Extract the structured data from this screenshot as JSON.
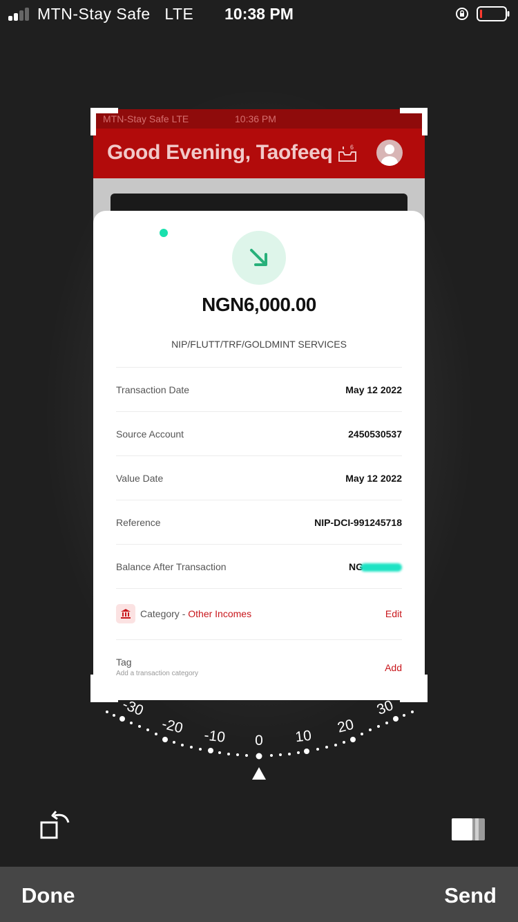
{
  "status_bar": {
    "carrier": "MTN-Stay Safe",
    "network": "LTE",
    "time": "10:38 PM"
  },
  "preview": {
    "mini_status": {
      "carrier": "MTN-Stay Safe  LTE",
      "time": "10:36 PM"
    },
    "header": {
      "greeting": "Good Evening, Taofeeq",
      "notification_count": "6"
    },
    "transaction": {
      "amount": "NGN6,000.00",
      "description": "NIP/FLUTT/TRF/GOLDMINT SERVICES",
      "rows": [
        {
          "label": "Transaction Date",
          "value": "May 12 2022"
        },
        {
          "label": "Source Account",
          "value": "2450530537"
        },
        {
          "label": "Value Date",
          "value": "May 12 2022"
        },
        {
          "label": "Reference",
          "value": "NIP-DCI-991245718"
        },
        {
          "label": "Balance After Transaction",
          "value": "NG"
        }
      ],
      "category": {
        "prefix": "Category - ",
        "value": "Other Incomes",
        "action": "Edit"
      },
      "tag": {
        "label": "Tag",
        "hint": "Add a transaction category",
        "action": "Add"
      }
    }
  },
  "dial": {
    "labels": [
      "-30",
      "-20",
      "-10",
      "0",
      "10",
      "20",
      "30"
    ]
  },
  "toolbar": {
    "done_label": "Done",
    "send_label": "Send"
  },
  "colors": {
    "brand_red": "#b20b0b",
    "accent_red": "#c8161b",
    "success_green": "#27b07a",
    "toolbar_bg": "#464646"
  }
}
